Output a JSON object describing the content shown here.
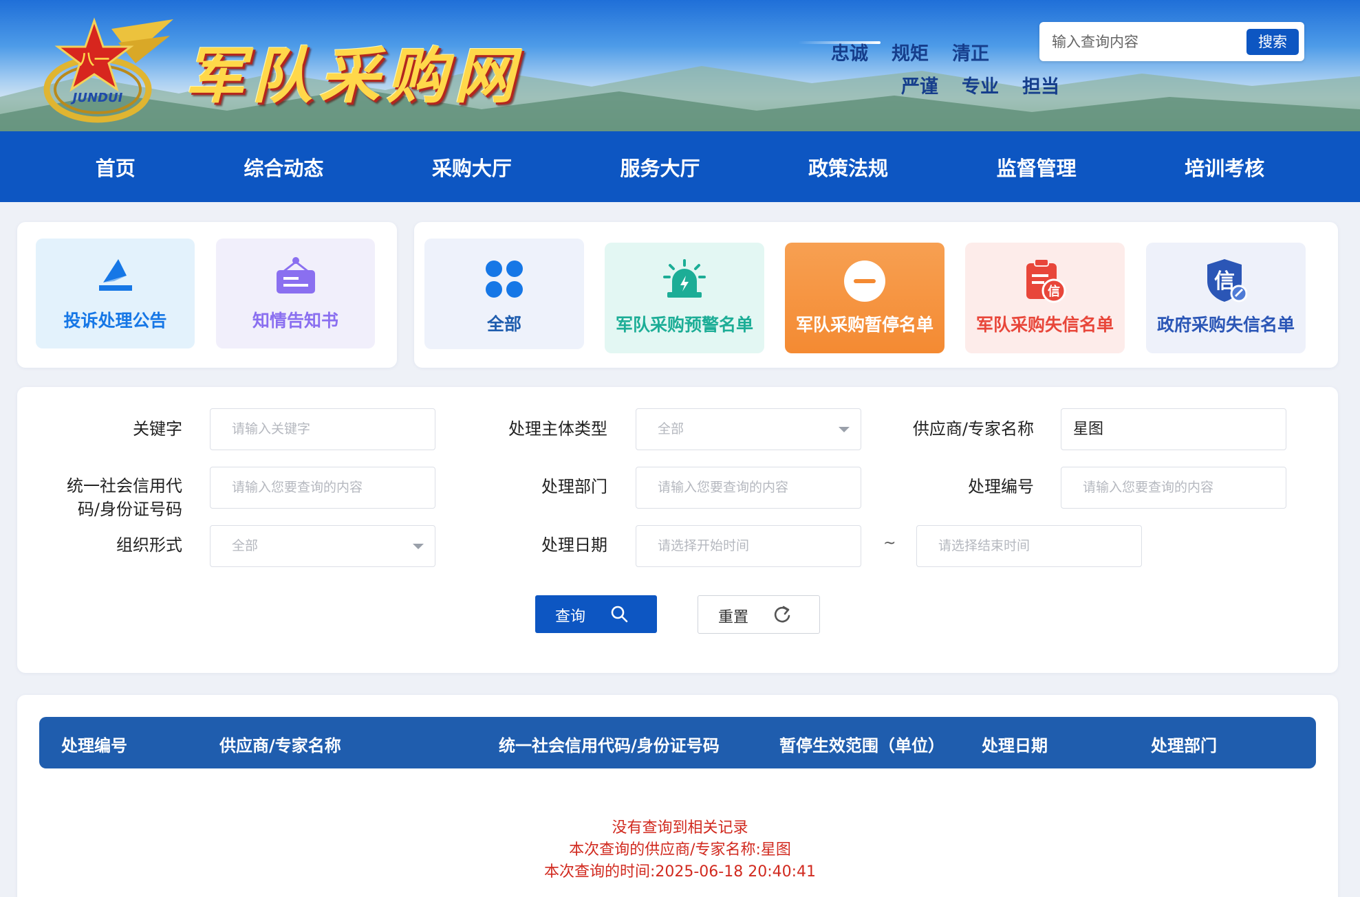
{
  "header": {
    "site_title": "军队采购网",
    "motto_row1": [
      "忠诚",
      "规矩",
      "清正"
    ],
    "motto_row2": [
      "严谨",
      "专业",
      "担当"
    ],
    "search_placeholder": "输入查询内容",
    "search_button": "搜索",
    "emblem_text": "JUNDUI"
  },
  "nav": {
    "items": [
      "首页",
      "综合动态",
      "采购大厅",
      "服务大厅",
      "政策法规",
      "监督管理",
      "培训考核"
    ]
  },
  "category_cards": {
    "left": [
      {
        "label": "投诉处理公告",
        "icon": "paper-plane-icon",
        "bg": "#e3f2fc",
        "color": "#1677e6"
      },
      {
        "label": "知情告知书",
        "icon": "signboard-icon",
        "bg": "#f1effb",
        "color": "#8a6ff0"
      }
    ],
    "right": [
      {
        "label": "全部",
        "icon": "four-petal-icon",
        "bg": "#eef2fb",
        "color": "#1f5dae"
      },
      {
        "label": "军队采购预警名单",
        "icon": "alarm-light-icon",
        "bg": "#e3f7f3",
        "color": "#1cad96"
      },
      {
        "label": "军队采购暂停名单",
        "icon": "minus-circle-icon",
        "bg": "#f6923c",
        "color": "#ffffff",
        "selected": true
      },
      {
        "label": "军队采购失信名单",
        "icon": "credit-clipboard-icon",
        "bg": "#fdecea",
        "color": "#e8463a"
      },
      {
        "label": "政府采购失信名单",
        "icon": "credit-shield-icon",
        "bg": "#eef1fa",
        "color": "#2b56b6"
      }
    ]
  },
  "search_form": {
    "keyword": {
      "label": "关键字",
      "placeholder": "请输入关键字"
    },
    "entity_type": {
      "label": "处理主体类型",
      "value": "全部"
    },
    "supplier_name": {
      "label": "供应商/专家名称",
      "value": "星图"
    },
    "credit_code": {
      "label": "统一社会信用代码/身份证号码",
      "placeholder": "请输入您要查询的内容"
    },
    "department": {
      "label": "处理部门",
      "placeholder": "请输入您要查询的内容"
    },
    "handle_no": {
      "label": "处理编号",
      "placeholder": "请输入您要查询的内容"
    },
    "org_form": {
      "label": "组织形式",
      "value": "全部"
    },
    "handle_date": {
      "label": "处理日期",
      "start_placeholder": "请选择开始时间",
      "end_placeholder": "请选择结束时间",
      "separator": "~"
    },
    "query_button": "查询",
    "reset_button": "重置"
  },
  "results": {
    "columns": [
      "处理编号",
      "供应商/专家名称",
      "统一社会信用代码/身份证号码",
      "暂停生效范围（单位）",
      "处理日期",
      "处理部门"
    ],
    "empty_message": "没有查询到相关记录",
    "query_supplier_line": "本次查询的供应商/专家名称:星图",
    "query_time_line": "本次查询的时间:2025-06-18 20:40:41"
  },
  "colors": {
    "primary": "#0d56c2",
    "table_header": "#1f5dae",
    "empty_text": "#d12a1f",
    "selected_card": "#f6923c"
  }
}
